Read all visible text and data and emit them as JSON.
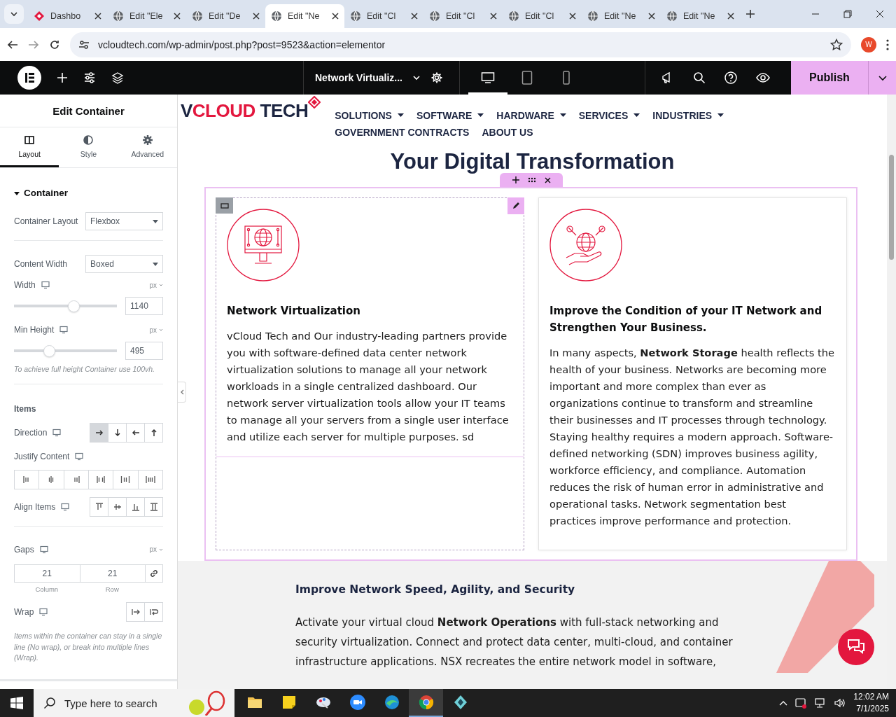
{
  "browser": {
    "tabs": [
      {
        "title": "Dashbo",
        "kind": "dashboard",
        "selected": false
      },
      {
        "title": "Edit \"Ele",
        "kind": "site",
        "selected": false
      },
      {
        "title": "Edit \"De",
        "kind": "site",
        "selected": false
      },
      {
        "title": "Edit \"Ne",
        "kind": "site",
        "selected": true
      },
      {
        "title": "Edit \"Cl",
        "kind": "site",
        "selected": false
      },
      {
        "title": "Edit \"Cl",
        "kind": "site",
        "selected": false
      },
      {
        "title": "Edit \"Cl",
        "kind": "site",
        "selected": false
      },
      {
        "title": "Edit \"Ne",
        "kind": "site",
        "selected": false
      },
      {
        "title": "Edit \"Ne",
        "kind": "site",
        "selected": false
      }
    ],
    "url": "vcloudtech.com/wp-admin/post.php?post=9523&action=elementor",
    "profile_initial": "W"
  },
  "editor_bar": {
    "document_title": "Network Virtualiz...",
    "devices": [
      {
        "kind": "desktop",
        "selected": true
      },
      {
        "kind": "tablet",
        "selected": false
      },
      {
        "kind": "mobile",
        "selected": false
      }
    ],
    "publish": "Publish"
  },
  "panel": {
    "title": "Edit Container",
    "tabs": [
      {
        "label": "Layout",
        "kind": "layout",
        "selected": true
      },
      {
        "label": "Style",
        "kind": "style",
        "selected": false
      },
      {
        "label": "Advanced",
        "kind": "advanced",
        "selected": false
      }
    ],
    "section": "Container",
    "container_layout": {
      "label": "Container Layout",
      "value": "Flexbox"
    },
    "content_width": {
      "label": "Content Width",
      "value": "Boxed"
    },
    "width": {
      "label": "Width",
      "unit": "px",
      "level": 0.58,
      "value": "1140"
    },
    "min_height": {
      "label": "Min Height",
      "unit": "px",
      "level": 0.34,
      "value": "495",
      "note": "To achieve full height Container use 100vh."
    },
    "items_heading": "Items",
    "direction": {
      "label": "Direction",
      "options": [
        {
          "kind": "right",
          "selected": true
        },
        {
          "kind": "down",
          "selected": false
        },
        {
          "kind": "left",
          "selected": false
        },
        {
          "kind": "up",
          "selected": false
        }
      ]
    },
    "justify_content": {
      "label": "Justify Content",
      "options": [
        {
          "kind": "start",
          "selected": false
        },
        {
          "kind": "center",
          "selected": false
        },
        {
          "kind": "end",
          "selected": false
        },
        {
          "kind": "between",
          "selected": false
        },
        {
          "kind": "around",
          "selected": false
        },
        {
          "kind": "evenly",
          "selected": false
        }
      ]
    },
    "align_items": {
      "label": "Align Items",
      "options": [
        {
          "kind": "top",
          "selected": false
        },
        {
          "kind": "middle",
          "selected": false
        },
        {
          "kind": "bottom",
          "selected": false
        },
        {
          "kind": "stretch",
          "selected": false
        }
      ]
    },
    "gaps": {
      "label": "Gaps",
      "unit": "px",
      "fields": [
        {
          "value": "21",
          "caption": "Column"
        },
        {
          "value": "21",
          "caption": "Row"
        }
      ]
    },
    "wrap": {
      "label": "Wrap",
      "options": [
        {
          "kind": "nowrap",
          "selected": false
        },
        {
          "kind": "wrap",
          "selected": false
        }
      ],
      "note": "Items within the container can stay in a single line (No wrap), or break into multiple lines (Wrap)."
    }
  },
  "page": {
    "logo": [
      {
        "text": "V",
        "color": "#1c2541"
      },
      {
        "text": "CLOUD",
        "color": "#e3173e"
      },
      {
        "text": " TECH",
        "color": "#1c2541"
      }
    ],
    "nav": [
      {
        "label": "SOLUTIONS",
        "dropdown": true
      },
      {
        "label": "SOFTWARE",
        "dropdown": true
      },
      {
        "label": "HARDWARE",
        "dropdown": true
      },
      {
        "label": "SERVICES",
        "dropdown": true
      },
      {
        "label": "INDUSTRIES",
        "dropdown": true
      },
      {
        "label": "GOVERNMENT CONTRACTS",
        "dropdown": false
      },
      {
        "label": "ABOUT US",
        "dropdown": false
      }
    ],
    "heading": "Your Digital Transformation",
    "cards": [
      {
        "title": "Network Virtualization",
        "body": "vCloud Tech and Our industry-leading partners provide you with software-defined data center network virtualization solutions to manage all your network workloads in a single centralized dashboard. Our network server virtualization tools allow your IT teams to manage all your servers from a single user interface and utilize each server for multiple purposes.  sd",
        "selected": true
      },
      {
        "title": "Improve the Condition of your IT Network and Strengthen Your Business.",
        "body": "In many aspects, **Network Storage** health reflects the health of your business. Networks are becoming more important and more complex than ever as organizations continue to transform and streamline their businesses and IT processes through technology. Staying healthy requires a modern approach. Software-defined networking (SDN) improves business agility, workforce efficiency, and compliance. Automation reduces the risk of human error in administrative and operational tasks. Network segmentation best practices improve performance and protection.",
        "selected": false
      }
    ],
    "section_heading": "Improve Network Speed, Agility, and Security",
    "section_body": " Activate your virtual cloud **Network Operations** with full-stack networking and security virtualization. Connect and protect data center, multi-cloud, and container infrastructure applications. NSX recreates the entire network model in software,"
  },
  "taskbar": {
    "search_placeholder": "Type here to search",
    "apps": [
      {
        "kind": "folder",
        "selected": false
      },
      {
        "kind": "notes",
        "selected": false
      },
      {
        "kind": "paint",
        "selected": false
      },
      {
        "kind": "video",
        "selected": false
      },
      {
        "kind": "browser",
        "selected": false
      },
      {
        "kind": "chrome",
        "selected": true
      },
      {
        "kind": "app",
        "selected": false
      }
    ],
    "time": "12:02 AM",
    "date": "7/1/2025"
  }
}
